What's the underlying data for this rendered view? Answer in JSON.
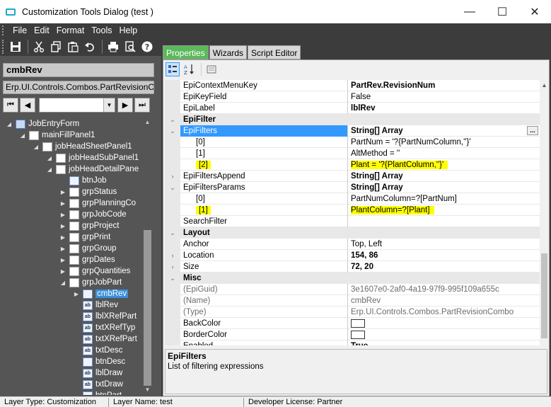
{
  "window": {
    "title": "Customization Tools Dialog  (test )",
    "controls": {
      "minimize": "—",
      "maximize": "☐",
      "close": "✕"
    }
  },
  "menu": [
    "File",
    "Edit",
    "Format",
    "Tools",
    "Help"
  ],
  "toolbar_icons": [
    "save-icon",
    "cut-icon",
    "copy-icon",
    "paste-icon",
    "undo-icon",
    "print-icon",
    "print-preview-icon",
    "help-icon"
  ],
  "left": {
    "object_name": "cmbRev",
    "object_type": "Erp.UI.Controls.Combos.PartRevisionCo",
    "tree": [
      {
        "label": "JobEntryForm",
        "level": 0,
        "expander": "◢",
        "icon": "form"
      },
      {
        "label": "mainFillPanel1",
        "level": 1,
        "expander": "◢",
        "icon": "panel"
      },
      {
        "label": "jobHeadSheetPanel1",
        "level": 2,
        "expander": "◢",
        "icon": "panel"
      },
      {
        "label": "jobHeadSubPanel1",
        "level": 3,
        "expander": "◢",
        "icon": "panel"
      },
      {
        "label": "jobHeadDetailPane",
        "level": 3,
        "expander": "◢",
        "icon": "panel"
      },
      {
        "label": "btnJob",
        "level": 4,
        "expander": "",
        "icon": "btn"
      },
      {
        "label": "grpStatus",
        "level": 4,
        "expander": "▶",
        "icon": "panel"
      },
      {
        "label": "grpPlanningCo",
        "level": 4,
        "expander": "▶",
        "icon": "panel"
      },
      {
        "label": "grpJobCode",
        "level": 4,
        "expander": "▶",
        "icon": "panel"
      },
      {
        "label": "grpProject",
        "level": 4,
        "expander": "▶",
        "icon": "panel"
      },
      {
        "label": "grpPrint",
        "level": 4,
        "expander": "▶",
        "icon": "panel"
      },
      {
        "label": "grpGroup",
        "level": 4,
        "expander": "▶",
        "icon": "panel"
      },
      {
        "label": "grpDates",
        "level": 4,
        "expander": "▶",
        "icon": "panel"
      },
      {
        "label": "grpQuantities",
        "level": 4,
        "expander": "▶",
        "icon": "panel"
      },
      {
        "label": "grpJobPart",
        "level": 4,
        "expander": "◢",
        "icon": "panel"
      },
      {
        "label": "cmbRev",
        "level": 5,
        "expander": "▶",
        "icon": "combo",
        "selected": true
      },
      {
        "label": "lblRev",
        "level": 5,
        "expander": "",
        "icon": "ab"
      },
      {
        "label": "lblXRefPart",
        "level": 5,
        "expander": "",
        "icon": "ab"
      },
      {
        "label": "txtXRefTyp",
        "level": 5,
        "expander": "",
        "icon": "ab"
      },
      {
        "label": "txtXRefPart",
        "level": 5,
        "expander": "",
        "icon": "ab"
      },
      {
        "label": "txtDesc",
        "level": 5,
        "expander": "",
        "icon": "ab"
      },
      {
        "label": "btnDesc",
        "level": 5,
        "expander": "",
        "icon": "btn"
      },
      {
        "label": "lblDraw",
        "level": 5,
        "expander": "",
        "icon": "ab"
      },
      {
        "label": "txtDraw",
        "level": 5,
        "expander": "",
        "icon": "ab"
      },
      {
        "label": "btnPart",
        "level": 5,
        "expander": "",
        "icon": "btn"
      }
    ]
  },
  "tabs": [
    "Properties",
    "Wizards",
    "Script Editor"
  ],
  "properties": [
    {
      "type": "prop",
      "name": "EpiContextMenuKey",
      "value": "PartRev.RevisionNum",
      "bold": true
    },
    {
      "type": "prop",
      "name": "EpiKeyField",
      "value": "False"
    },
    {
      "type": "prop",
      "name": "EpiLabel",
      "value": "lblRev",
      "bold": true
    },
    {
      "type": "cat",
      "name": "EpiFilter"
    },
    {
      "type": "prop",
      "name": "EpiFilters",
      "value": "String[] Array",
      "bold": true,
      "selected": true,
      "margin": "⌄",
      "ellipsis": "..."
    },
    {
      "type": "prop",
      "name": "[0]",
      "value": "PartNum = '?{PartNumColumn,''}'",
      "indent": true
    },
    {
      "type": "prop",
      "name": "[1]",
      "value": "AltMethod = ''",
      "indent": true
    },
    {
      "type": "prop",
      "name": "[2]",
      "value": "Plant = '?{PlantColumn,''}'",
      "indent": true,
      "highlight": true
    },
    {
      "type": "prop",
      "name": "EpiFiltersAppend",
      "value": "String[] Array",
      "bold": true,
      "margin": "›"
    },
    {
      "type": "prop",
      "name": "EpiFiltersParams",
      "value": "String[] Array",
      "bold": true,
      "margin": "⌄"
    },
    {
      "type": "prop",
      "name": "[0]",
      "value": "PartNumColumn=?[PartNum]",
      "indent": true
    },
    {
      "type": "prop",
      "name": "[1]",
      "value": "PlantColumn=?[Plant]",
      "indent": true,
      "highlight": true
    },
    {
      "type": "prop",
      "name": "SearchFilter",
      "value": ""
    },
    {
      "type": "cat",
      "name": "Layout"
    },
    {
      "type": "prop",
      "name": "Anchor",
      "value": "Top, Left"
    },
    {
      "type": "prop",
      "name": "Location",
      "value": "154, 86",
      "bold": true,
      "margin": "›"
    },
    {
      "type": "prop",
      "name": "Size",
      "value": "72, 20",
      "bold": true,
      "margin": "›"
    },
    {
      "type": "cat",
      "name": "Misc"
    },
    {
      "type": "prop",
      "name": "(EpiGuid)",
      "value": "3e1607e0-2af0-4a19-97f9-995f109a655c",
      "grey": true
    },
    {
      "type": "prop",
      "name": "(Name)",
      "value": "cmbRev",
      "grey": true
    },
    {
      "type": "prop",
      "name": "(Type)",
      "value": "Erp.UI.Controls.Combos.PartRevisionCombo",
      "grey": true
    },
    {
      "type": "prop",
      "name": "BackColor",
      "value": "",
      "swatch": true
    },
    {
      "type": "prop",
      "name": "BorderColor",
      "value": "",
      "swatch": true
    },
    {
      "type": "prop",
      "name": "Enabled",
      "value": "True",
      "bold": true
    }
  ],
  "description": {
    "title": "EpiFilters",
    "text": "List of filtering expressions"
  },
  "status": [
    "Layer Type:  Customization",
    "Layer Name:  test",
    "Developer License:  Partner"
  ],
  "colors": {
    "accent": "#3399ff",
    "tab_active": "#5bb95b",
    "highlight": "#ffff00",
    "dark_bg": "#3c3c3c"
  }
}
